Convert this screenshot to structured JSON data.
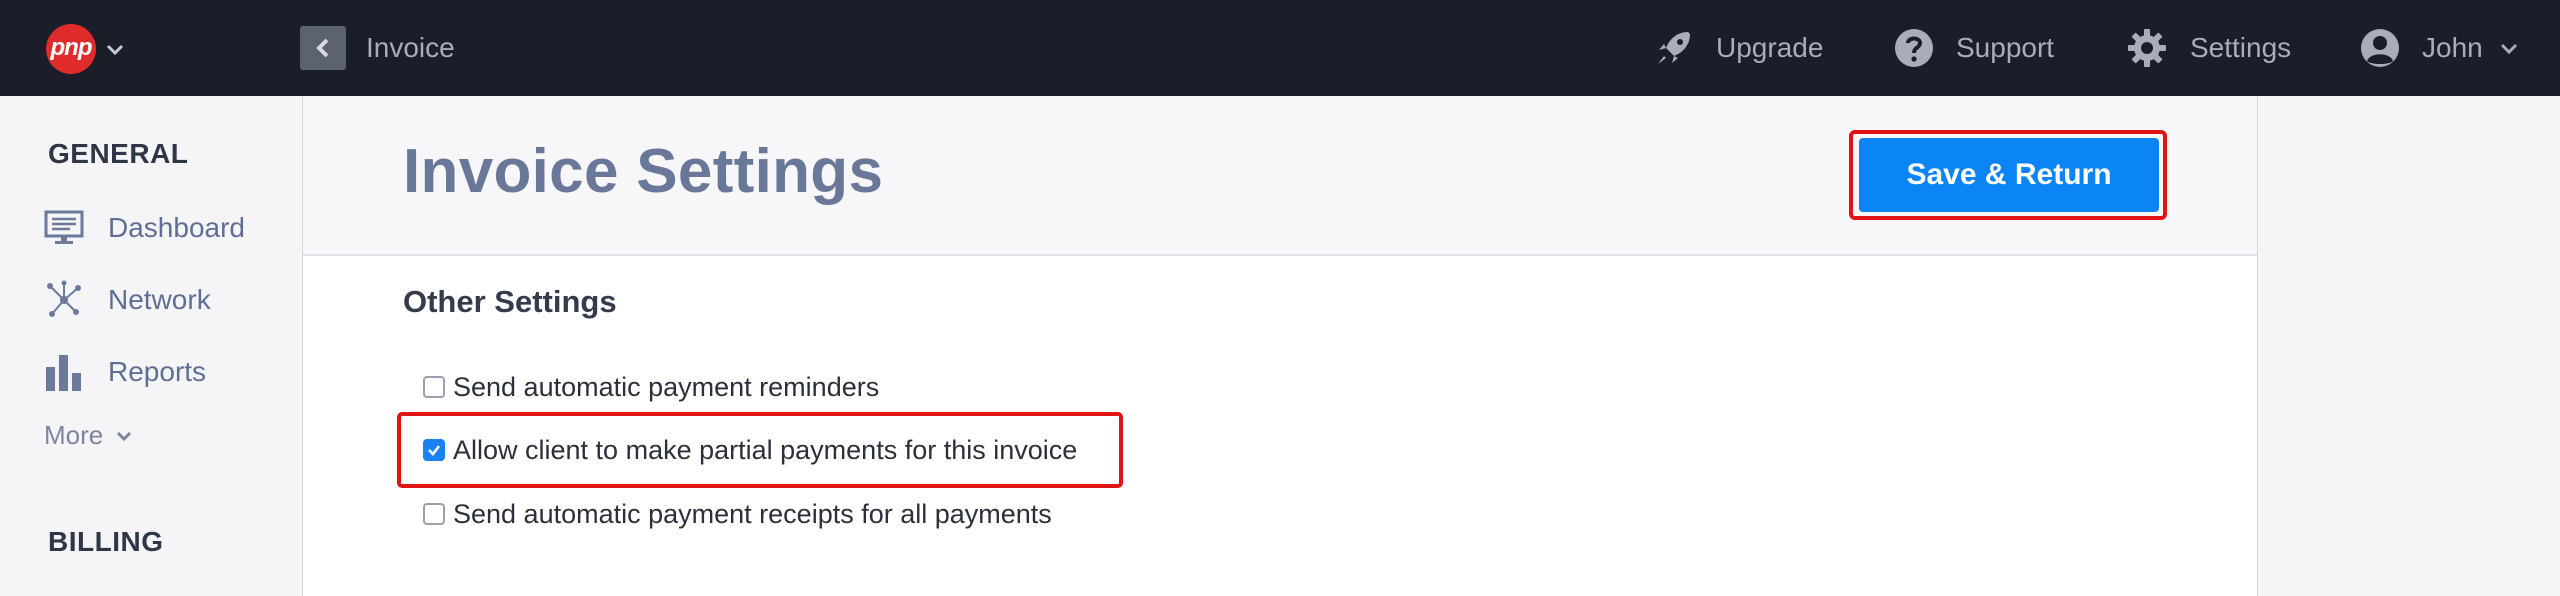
{
  "topbar": {
    "logo_text": "pnp",
    "breadcrumb": "Invoice",
    "nav": {
      "upgrade": "Upgrade",
      "support": "Support",
      "settings": "Settings",
      "user": "John"
    }
  },
  "sidebar": {
    "general_heading": "GENERAL",
    "items": [
      {
        "label": "Dashboard",
        "icon": "monitor-icon"
      },
      {
        "label": "Network",
        "icon": "network-icon"
      },
      {
        "label": "Reports",
        "icon": "bar-chart-icon"
      }
    ],
    "more_label": "More",
    "billing_heading": "BILLING"
  },
  "main": {
    "title": "Invoice Settings",
    "save_label": "Save & Return",
    "section_title": "Other Settings",
    "options": [
      {
        "label": "Send automatic payment reminders",
        "checked": false
      },
      {
        "label": "Allow client to make partial payments for this invoice",
        "checked": true
      },
      {
        "label": "Send automatic payment receipts for all payments",
        "checked": false
      }
    ]
  },
  "colors": {
    "topbar_bg": "#1b1d29",
    "accent_blue": "#0b84f5",
    "highlight_red": "#e01414",
    "logo_red": "#e02b2b"
  }
}
